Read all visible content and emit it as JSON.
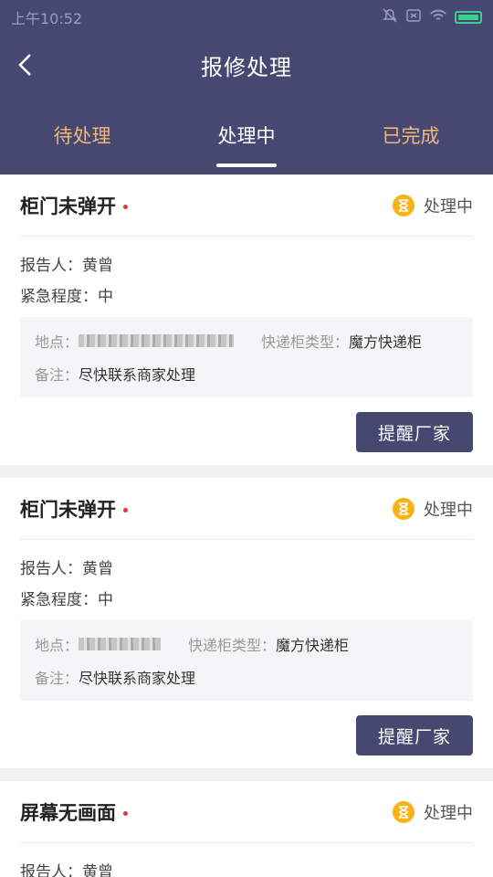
{
  "status_bar": {
    "time": "上午10:52"
  },
  "nav": {
    "title": "报修处理"
  },
  "tabs": [
    {
      "label": "待处理"
    },
    {
      "label": "处理中"
    },
    {
      "label": "已完成"
    }
  ],
  "labels": {
    "reporter": "报告人：",
    "urgency": "紧急程度：",
    "location": "地点：",
    "locker_type": "快递柜类型：",
    "remark": "备注：",
    "remind": "提醒厂家"
  },
  "cards": [
    {
      "title": "柜门未弹开",
      "status": "处理中",
      "reporter": "黄曾",
      "urgency": "中",
      "locker_type": "魔方快递柜",
      "remark": "尽快联系商家处理"
    },
    {
      "title": "柜门未弹开",
      "status": "处理中",
      "reporter": "黄曾",
      "urgency": "中",
      "locker_type": "魔方快递柜",
      "remark": "尽快联系商家处理"
    },
    {
      "title": "屏幕无画面",
      "status": "处理中",
      "reporter": "黄曾"
    }
  ],
  "colors": {
    "header": "#474872",
    "accent_tab": "#f0b77a",
    "status_icon": "#f7b318",
    "dot": "#e6352f"
  }
}
